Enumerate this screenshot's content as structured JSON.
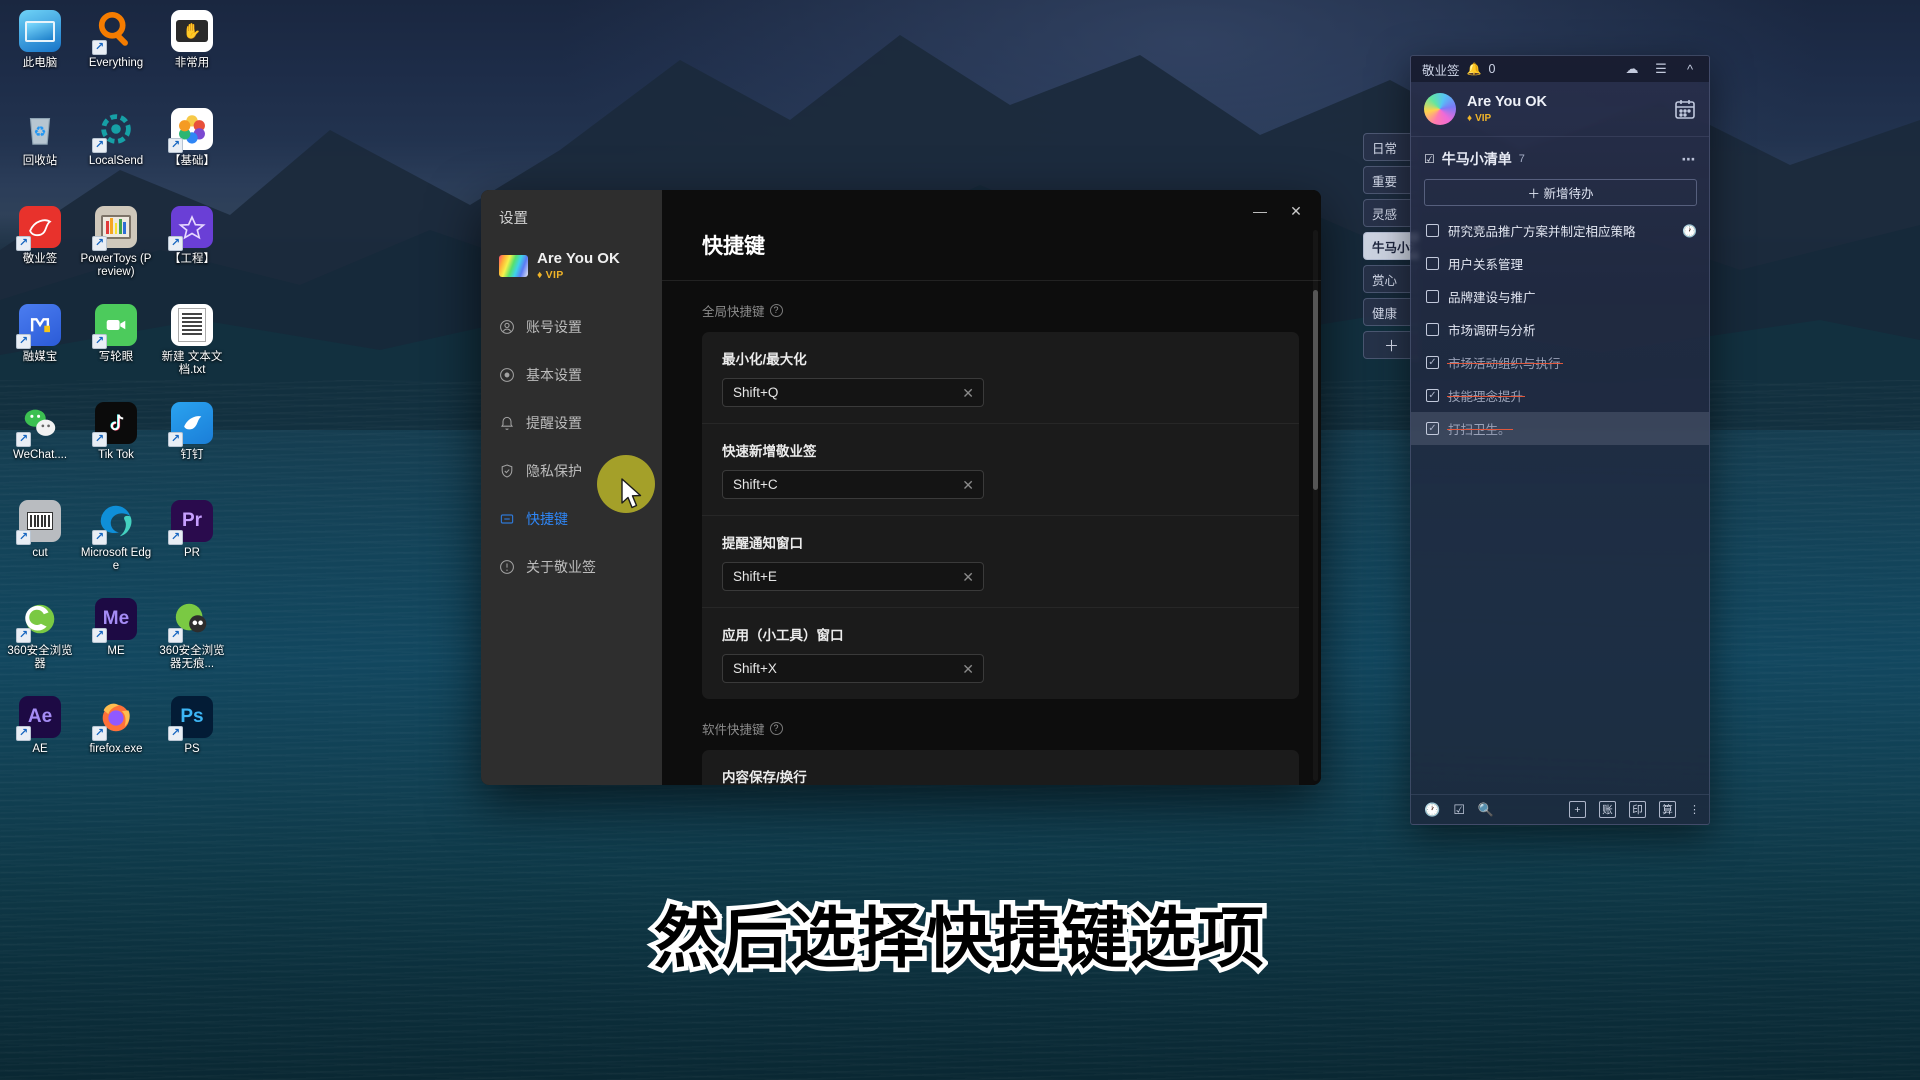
{
  "desktop": {
    "icons": [
      {
        "label": "此电脑",
        "icon": "this-pc-icon",
        "shortcut": false
      },
      {
        "label": "Everything",
        "icon": "everything-icon",
        "shortcut": true
      },
      {
        "label": "非常用",
        "icon": "folder-app-icon",
        "shortcut": false
      },
      {
        "label": "回收站",
        "icon": "recycle-bin-icon",
        "shortcut": false
      },
      {
        "label": "LocalSend",
        "icon": "localsend-icon",
        "shortcut": true
      },
      {
        "label": "【基础】",
        "icon": "photos-icon",
        "shortcut": true
      },
      {
        "label": "敬业签",
        "icon": "jingyeqian-icon",
        "shortcut": true
      },
      {
        "label": "PowerToys (Preview)",
        "icon": "powertoys-icon",
        "shortcut": true
      },
      {
        "label": "【工程】",
        "icon": "star-folder-icon",
        "shortcut": true
      },
      {
        "label": "融媒宝",
        "icon": "rongmeibao-icon",
        "shortcut": true
      },
      {
        "label": "写轮眼",
        "icon": "xielunyan-icon",
        "shortcut": true
      },
      {
        "label": "新建 文本文档.txt",
        "icon": "text-file-icon",
        "shortcut": false
      },
      {
        "label": "WeChat....",
        "icon": "wechat-icon",
        "shortcut": true
      },
      {
        "label": "Tik Tok",
        "icon": "tiktok-icon",
        "shortcut": true
      },
      {
        "label": "钉钉",
        "icon": "dingtalk-icon",
        "shortcut": true
      },
      {
        "label": "cut",
        "icon": "cut-icon",
        "shortcut": true
      },
      {
        "label": "Microsoft Edge",
        "icon": "edge-icon",
        "shortcut": true
      },
      {
        "label": "PR",
        "icon": "premiere-icon",
        "shortcut": true
      },
      {
        "label": "360安全浏览器",
        "icon": "360-browser-icon",
        "shortcut": true
      },
      {
        "label": "ME",
        "icon": "media-encoder-icon",
        "shortcut": true
      },
      {
        "label": "360安全浏览器无痕...",
        "icon": "360-incognito-icon",
        "shortcut": true
      },
      {
        "label": "AE",
        "icon": "after-effects-icon",
        "shortcut": true
      },
      {
        "label": "firefox.exe",
        "icon": "firefox-icon",
        "shortcut": true
      },
      {
        "label": "PS",
        "icon": "photoshop-icon",
        "shortcut": true
      }
    ]
  },
  "settings_window": {
    "title": "设置",
    "user": {
      "name": "Are You OK",
      "vip_label": "VIP"
    },
    "nav_items": [
      {
        "label": "账号设置",
        "icon": "account-icon",
        "active": false
      },
      {
        "label": "基本设置",
        "icon": "basic-settings-icon",
        "active": false
      },
      {
        "label": "提醒设置",
        "icon": "bell-icon",
        "active": false
      },
      {
        "label": "隐私保护",
        "icon": "shield-icon",
        "active": false
      },
      {
        "label": "快捷键",
        "icon": "keyboard-icon",
        "active": true
      },
      {
        "label": "关于敬业签",
        "icon": "info-icon",
        "active": false
      }
    ],
    "window_controls": {
      "minimize": "—",
      "close": "✕"
    },
    "page_title": "快捷键",
    "sections": [
      {
        "title": "全局快捷键",
        "rows": [
          {
            "label": "最小化/最大化",
            "value": "Shift+Q",
            "clear": "✕"
          },
          {
            "label": "快速新增敬业签",
            "value": "Shift+C",
            "clear": "✕"
          },
          {
            "label": "提醒通知窗口",
            "value": "Shift+E",
            "clear": "✕"
          },
          {
            "label": "应用（小工具）窗口",
            "value": "Shift+X",
            "clear": "✕"
          }
        ]
      },
      {
        "title": "软件快捷键",
        "rows": [
          {
            "label": "内容保存/换行",
            "value": "",
            "clear": "✕"
          }
        ]
      }
    ]
  },
  "note_window": {
    "titlebar": {
      "app_name": "敬业签",
      "bell_icon": "bell-icon",
      "notification_count": "0",
      "cloud_icon": "cloud-sync-icon",
      "menu_icon": "hamburger-menu-icon",
      "collapse_icon": "chevron-up-icon"
    },
    "user": {
      "name": "Are You OK",
      "vip_label": "VIP",
      "calendar_icon": "calendar-icon"
    },
    "list_header": {
      "title": "牛马小清单",
      "count": "7",
      "more_icon": "more-dots-icon",
      "list-icon": "checklist-icon"
    },
    "add_button": "＋ 新增待办",
    "todos": [
      {
        "text": "研究竞品推广方案并制定相应策略",
        "done": false,
        "has_clock": true,
        "selected": false
      },
      {
        "text": "用户关系管理",
        "done": false,
        "has_clock": false,
        "selected": false
      },
      {
        "text": "品牌建设与推广",
        "done": false,
        "has_clock": false,
        "selected": false
      },
      {
        "text": "市场调研与分析",
        "done": false,
        "has_clock": false,
        "selected": false
      },
      {
        "text": "市场活动组织与执行",
        "done": true,
        "has_clock": false,
        "selected": false
      },
      {
        "text": "技能理念提升",
        "done": true,
        "has_clock": false,
        "selected": false
      },
      {
        "text": "打扫卫生。",
        "done": true,
        "has_clock": false,
        "selected": true
      }
    ],
    "tabs": [
      {
        "label": "日常",
        "active": false
      },
      {
        "label": "重要",
        "active": false
      },
      {
        "label": "灵感",
        "active": false
      },
      {
        "label": "牛马小清单",
        "active": true
      },
      {
        "label": "赏心",
        "active": false
      },
      {
        "label": "健康",
        "active": false
      },
      {
        "label": "＋",
        "active": false
      }
    ],
    "toolbar": {
      "left": [
        {
          "icon": "clock-icon",
          "label": "🕐"
        },
        {
          "icon": "checklist-icon",
          "label": "☑"
        },
        {
          "icon": "search-icon",
          "label": "🔍"
        }
      ],
      "right": [
        {
          "icon": "add-icon",
          "label": "+"
        },
        {
          "icon": "ledger-icon",
          "label": "账"
        },
        {
          "icon": "stamp-icon",
          "label": "印"
        },
        {
          "icon": "calc-icon",
          "label": "算"
        }
      ],
      "overflow_icon": "vertical-dots-icon"
    }
  },
  "caption": {
    "text": "然后选择快捷键选项"
  },
  "colors": {
    "accent_blue": "#2f86f6",
    "vip_gold": "#f0b429",
    "strike_red": "#e0573c",
    "click_halo": "#bebc28"
  }
}
